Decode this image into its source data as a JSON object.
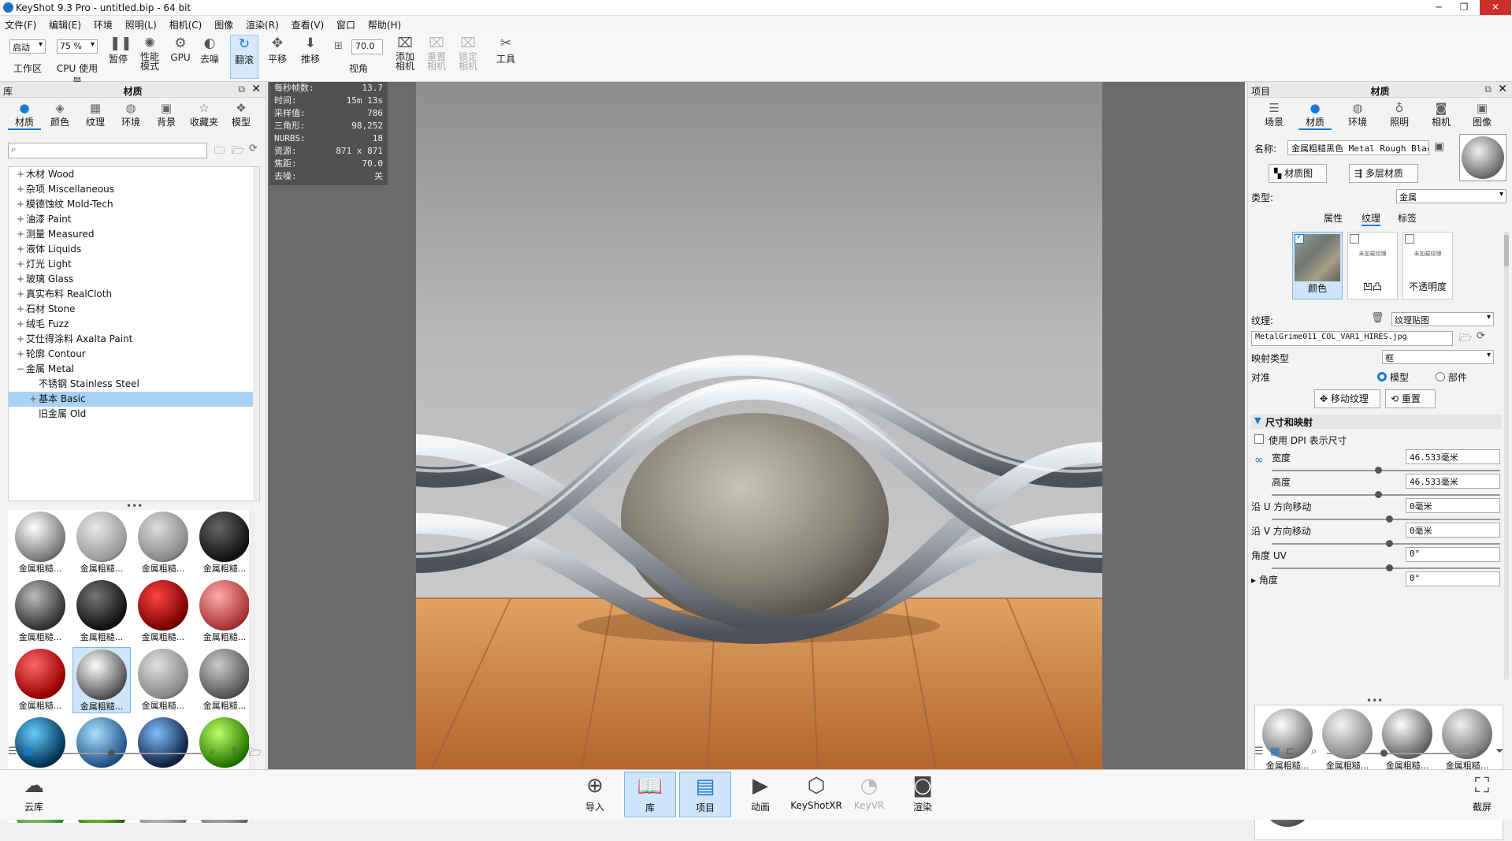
{
  "window": {
    "title": "KeyShot 9.3 Pro  - untitled.bip  - 64 bit",
    "min": "─",
    "max": "❐",
    "close": "✕"
  },
  "menu": [
    "文件(F)",
    "编辑(E)",
    "环境",
    "照明(L)",
    "相机(C)",
    "图像",
    "渲染(R)",
    "查看(V)",
    "窗口",
    "帮助(H)"
  ],
  "toolbar": {
    "workspace_value": "启动",
    "workspace_label": "工作区",
    "cpu_value": "75 %",
    "cpu_label": "CPU 使用量",
    "pause": "暂停",
    "perf": "性能\n模式",
    "gpu": "GPU",
    "denoise": "去噪",
    "tumble": "翻滚",
    "pan": "平移",
    "dolly": "推移",
    "fov_value": "70.0",
    "fov_label": "视角",
    "add_camera": "添加\n相机",
    "reset_camera": "重置\n相机",
    "lock_camera": "锁定\n相机",
    "tools": "工具"
  },
  "library": {
    "header_left": "库",
    "title": "材质",
    "tabs": [
      "材质",
      "颜色",
      "纹理",
      "环境",
      "背景",
      "收藏夹",
      "模型"
    ],
    "tree": [
      {
        "pm": "+",
        "label": "木材 Wood",
        "indent": 1
      },
      {
        "pm": "+",
        "label": "杂项 Miscellaneous",
        "indent": 1
      },
      {
        "pm": "+",
        "label": "模德蚀纹 Mold-Tech",
        "indent": 1
      },
      {
        "pm": "+",
        "label": "油漆 Paint",
        "indent": 1
      },
      {
        "pm": "+",
        "label": "测量 Measured",
        "indent": 1
      },
      {
        "pm": "+",
        "label": "液体 Liquids",
        "indent": 1
      },
      {
        "pm": "+",
        "label": "灯光 Light",
        "indent": 1
      },
      {
        "pm": "+",
        "label": "玻璃 Glass",
        "indent": 1
      },
      {
        "pm": "+",
        "label": "真实布料 RealCloth",
        "indent": 1
      },
      {
        "pm": "+",
        "label": "石材 Stone",
        "indent": 1
      },
      {
        "pm": "+",
        "label": "绒毛 Fuzz",
        "indent": 1
      },
      {
        "pm": "+",
        "label": "艾仕得涂料 Axalta Paint",
        "indent": 1
      },
      {
        "pm": "+",
        "label": "轮廓 Contour",
        "indent": 1
      },
      {
        "pm": "−",
        "label": "金属 Metal",
        "indent": 1
      },
      {
        "pm": "",
        "label": "不锈钢 Stainless Steel",
        "indent": 2
      },
      {
        "pm": "+",
        "label": "基本 Basic",
        "indent": 2,
        "sel": true
      },
      {
        "pm": "",
        "label": "旧金属 Old",
        "indent": 2
      }
    ],
    "thumb_label": "金属粗糙...",
    "thumbs": [
      {
        "c1": "#ffffff",
        "c2": "#777"
      },
      {
        "c1": "#e8e8e8",
        "c2": "#999"
      },
      {
        "c1": "#dddddd",
        "c2": "#888"
      },
      {
        "c1": "#666",
        "c2": "#111"
      },
      {
        "c1": "#bbbbbb",
        "c2": "#333"
      },
      {
        "c1": "#777",
        "c2": "#111"
      },
      {
        "c1": "#ff4444",
        "c2": "#7a0000"
      },
      {
        "c1": "#ffaaaa",
        "c2": "#a33"
      },
      {
        "c1": "#ff6666",
        "c2": "#900"
      },
      {
        "c1": "#ffffff",
        "c2": "#555",
        "sel": true
      },
      {
        "c1": "#e0e0e0",
        "c2": "#888"
      },
      {
        "c1": "#cccccc",
        "c2": "#555"
      },
      {
        "c1": "#66ccff",
        "c2": "#035"
      },
      {
        "c1": "#aee0ff",
        "c2": "#258"
      },
      {
        "c1": "#7fbfff",
        "c2": "#124"
      },
      {
        "c1": "#bfff66",
        "c2": "#270"
      },
      {
        "c1": "#ccff99",
        "c2": "#383"
      },
      {
        "c1": "#bbff88",
        "c2": "#360"
      },
      {
        "c1": "#ffffff",
        "c2": "#777"
      },
      {
        "c1": "#f0f0f0",
        "c2": "#666"
      }
    ]
  },
  "stats": [
    {
      "k": "每秒帧数:",
      "v": "13.7"
    },
    {
      "k": "时间:",
      "v": "15m 13s"
    },
    {
      "k": "采样值:",
      "v": "786"
    },
    {
      "k": "三角形:",
      "v": "98,252"
    },
    {
      "k": "NURBS:",
      "v": "18"
    },
    {
      "k": "资源:",
      "v": "871 x 871"
    },
    {
      "k": "焦距:",
      "v": "70.0"
    },
    {
      "k": "去噪:",
      "v": "关"
    }
  ],
  "project": {
    "header_left": "项目",
    "title": "材质",
    "tabs": [
      "场景",
      "材质",
      "环境",
      "照明",
      "相机",
      "图像"
    ],
    "name_label": "名称:",
    "name_value": "金属粗糙黑色 Metal Rough Black",
    "graph_btn": "材质图",
    "multilayer_btn": "多层材质",
    "type_label": "类型:",
    "type_value": "金属",
    "subtabs": [
      "属性",
      "纹理",
      "标签"
    ],
    "tex_slots": [
      {
        "label": "颜色",
        "checked": true
      },
      {
        "label": "凹凸",
        "checked": false
      },
      {
        "label": "不透明度",
        "checked": false
      }
    ],
    "no_texture": "未加载纹理",
    "texture_label": "纹理:",
    "texture_type": "纹理贴图",
    "texture_file": "MetalGrime011_COL_VAR1_HIRES.jpg",
    "mapping_label": "映射类型",
    "mapping_value": "框",
    "align_label": "对准",
    "align_model": "模型",
    "align_part": "部件",
    "move_tex_btn": "移动纹理",
    "reset_btn": "重置",
    "section": "尺寸和映射",
    "dpi_label": "使用 DPI 表示尺寸",
    "params": [
      {
        "label": "宽度",
        "value": "46.533毫米",
        "knob": 0.45
      },
      {
        "label": "高度",
        "value": "46.533毫米",
        "knob": 0.45
      },
      {
        "label": "沿 U 方向移动",
        "value": "0毫米",
        "knob": 0.5
      },
      {
        "label": "沿 V 方向移动",
        "value": "0毫米",
        "knob": 0.5
      },
      {
        "label": "角度 UV",
        "value": "0°",
        "knob": 0.5
      },
      {
        "label": "▸ 角度",
        "value": "0°"
      }
    ],
    "used_label": "金属粗糙...",
    "used": [
      {
        "c1": "#ffffff",
        "c2": "#777"
      },
      {
        "c1": "#f5f5f5",
        "c2": "#888"
      },
      {
        "c1": "#ffffff",
        "c2": "#666"
      },
      {
        "c1": "#f0f0f0",
        "c2": "#777"
      },
      {
        "c1": "#cfcfc8",
        "c2": "#555"
      }
    ]
  },
  "bottombar": {
    "cloud": "云库",
    "import": "导入",
    "library": "库",
    "project": "项目",
    "animation": "动画",
    "keyshotxr": "KeyShotXR",
    "keyvr": "KeyVR",
    "render": "渲染",
    "screenshot": "截屏"
  }
}
